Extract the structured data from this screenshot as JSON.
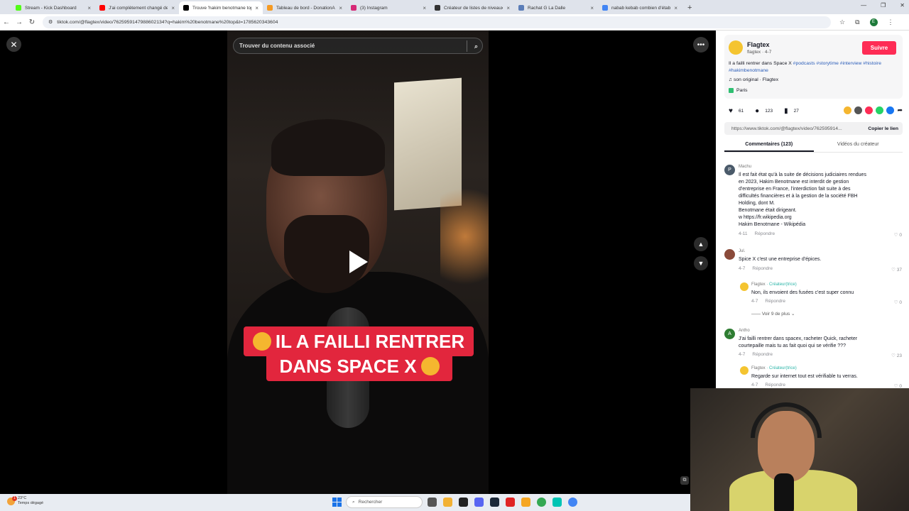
{
  "browser": {
    "tabs": [
      {
        "title": "Stream - Kick Dashboard",
        "color": "#53fc18"
      },
      {
        "title": "J'ai complètement changé de",
        "color": "#ff0000"
      },
      {
        "title": "Trouve 'hakim benotmane top",
        "color": "#000000",
        "active": true
      },
      {
        "title": "Tableau de bord - DonationAle",
        "color": "#f59a23"
      },
      {
        "title": "(3) Instagram",
        "color": "#d62976"
      },
      {
        "title": "Créateur de listes de niveaux p",
        "color": "#333333"
      },
      {
        "title": "Rachat G La Dalle",
        "color": "#5b7db8"
      },
      {
        "title": "nabab kebab combien d'établi",
        "color": "#4285f4"
      }
    ],
    "url": "tiktok.com/@flagtex/video/7625959147988602134?q=hakim%20benotmane%20top&t=1785620343604",
    "profile_initial": "E"
  },
  "video": {
    "search_placeholder": "Trouver du contenu associé",
    "caption_line1": "IL A FAILLI RENTRER",
    "caption_line2": "DANS SPACE X"
  },
  "post": {
    "username": "Flagtex",
    "handle_date": "flagtex · 4-7",
    "follow_label": "Suivre",
    "description": "Il a failli rentrer dans Space X",
    "hashtags": [
      "#podcasts",
      "#storytime",
      "#interview",
      "#histoire",
      "#hakimbenotmane"
    ],
    "music": "son original · Flagtex",
    "location": "Paris",
    "likes": "61",
    "comments": "123",
    "saves": "27",
    "link": "https://www.tiktok.com/@flagtex/video/762595914...",
    "copy_label": "Copier le lien",
    "share_colors": [
      "#f5b62f",
      "#555555",
      "#fe2c55",
      "#25d366",
      "#1877f2"
    ]
  },
  "panel_tabs": {
    "comments": "Commentaires (123)",
    "creator_videos": "Vidéos du créateur"
  },
  "comments": [
    {
      "user": "Machu",
      "avatar_letter": "P",
      "avatar_color": "#4a5a6a",
      "lines": [
        "Il est fait état qu'à la suite de décisions judiciaires rendues",
        "en 2023, Hakim Benotmane est interdit de gestion",
        "d'entreprise en France, l'interdiction fait suite à des",
        "difficultés financières et à la gestion de la société FBH",
        "Holding, dont M.",
        "Benotmane était dirigeant.",
        "w https://fr.wikipedia.org",
        "Hakim Benotmane - Wikipédia"
      ],
      "date": "4-11",
      "reply": "Répondre",
      "likes": "0"
    },
    {
      "user": "Jul.",
      "avatar_color": "#8a4a3a",
      "text": "Spice X c'est une entreprise d'épices.",
      "date": "4-7",
      "reply": "Répondre",
      "likes": "37"
    },
    {
      "user": "Flagtex",
      "creator_tag": "· Créateur(trice)",
      "text": "Non, ils envoient des fusées c'est super connu",
      "date": "4-7",
      "reply": "Répondre",
      "likes": "0"
    },
    {
      "see_more": "Voir 9 de plus"
    },
    {
      "user": "Antho",
      "avatar_letter": "A",
      "avatar_color": "#2e7d32",
      "lines": [
        "J'ai failli rentrer dans spacex, racheter Quick, racheter",
        "courtepaille mais tu as fait quoi qui se vérifie ???"
      ],
      "date": "4-7",
      "reply": "Répondre",
      "likes": "23"
    },
    {
      "user": "Flagtex",
      "creator_tag": "· Créateur(trice)",
      "text": "Regarde sur internet tout est vérifiable tu verras.",
      "date": "4-7",
      "reply": "Répondre",
      "likes": "0"
    }
  ],
  "taskbar": {
    "temperature": "23°C",
    "weather": "Temps dégagé",
    "notif_count": "1",
    "search_placeholder": "Rechercher",
    "app_colors": [
      "#555555",
      "#f2b134",
      "#222222",
      "#5865f2",
      "#1b2838",
      "#e02424",
      "#f5a623",
      "#34a853",
      "#00c4b4",
      "#4285f4"
    ]
  }
}
